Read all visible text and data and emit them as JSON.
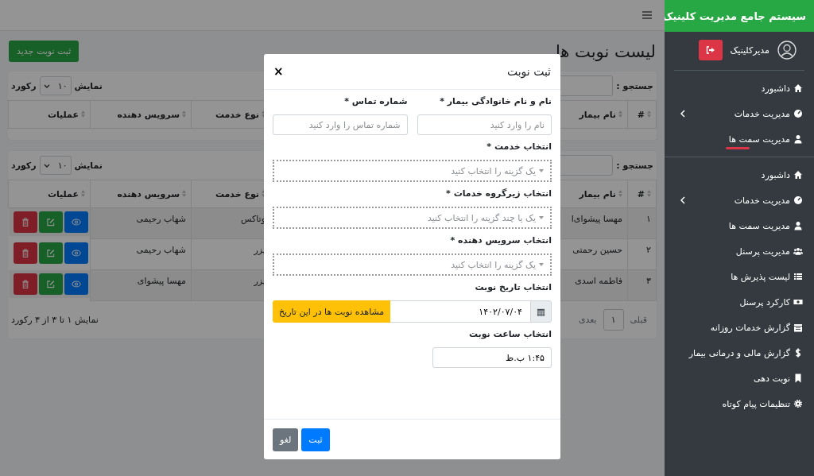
{
  "sidebar": {
    "brand": "سیستم جامع مدیریت کلینیک",
    "user": "مدیرکلینیک",
    "menus": [
      {
        "underline": true,
        "items": [
          {
            "label": "داشبورد",
            "has_submenu": false
          },
          {
            "label": "مدیریت خدمات",
            "has_submenu": true
          },
          {
            "label": "مدیریت سمت ها",
            "has_submenu": false
          }
        ]
      },
      {
        "underline": false,
        "items": [
          {
            "label": "داشبورد",
            "has_submenu": false
          },
          {
            "label": "مدیریت خدمات",
            "has_submenu": true
          },
          {
            "label": "مدیریت سمت ها",
            "has_submenu": false
          },
          {
            "label": "مدیریت پرسنل",
            "has_submenu": false
          },
          {
            "label": "لیست پذیرش ها",
            "has_submenu": false
          },
          {
            "label": "کارکرد پرسنل",
            "has_submenu": false
          },
          {
            "label": "گزارش خدمات روزانه",
            "has_submenu": false
          },
          {
            "label": "گزارش مالی و درمانی بیمار",
            "has_submenu": false
          },
          {
            "label": "نوبت دهی",
            "has_submenu": false
          },
          {
            "label": "تنظیمات پیام کوتاه",
            "has_submenu": false
          }
        ]
      }
    ]
  },
  "page": {
    "title": "لیست نوبت ها",
    "new_button": "ثبت نوبت جدید",
    "tables": [
      {
        "clipped": true,
        "search_label": "جستجو :",
        "show_label": "نمایش",
        "page_size": "۱۰",
        "records_label": "رکورد",
        "columns": [
          "#",
          "نام بیمار",
          "نوع خدمت",
          "سرویس دهنده",
          "عملیات"
        ]
      },
      {
        "clipped": false,
        "search_label": "جستجو :",
        "show_label": "نمایش",
        "page_size": "۱۰",
        "records_label": "رکورد",
        "columns": [
          "#",
          "نام بیمار",
          "نوع خدمت",
          "سرویس دهنده",
          "عملیات"
        ],
        "rows": [
          {
            "number": "۱",
            "patient": "مهسا پیشوای‌ا",
            "service": "وتاکس",
            "provider": "شهاب رحیمی"
          },
          {
            "number": "۲",
            "patient": "حسین رحمتی",
            "service": "یزر",
            "provider": "شهاب رحیمی"
          },
          {
            "number": "۳",
            "patient": "فاطمه اسدی",
            "service": "یزر",
            "provider": "مهسا پیشوای"
          }
        ],
        "prev": "قبلی",
        "current_page": "۱",
        "next": "بعدی",
        "info": "نمایش ۱ تا ۳ از ۳ رکورد"
      }
    ]
  },
  "modal": {
    "title": "ثبت نوبت",
    "close": "×",
    "fields": [
      {
        "kind": "text",
        "label": "نام و نام خانوادگی بیمار *",
        "placeholder": "نام را وارد کنید"
      },
      {
        "kind": "text",
        "label": "شماره تماس *",
        "placeholder": "شماره تماس را وارد کنید"
      },
      {
        "kind": "select",
        "label": "انتخاب خدمت *",
        "placeholder": "یک گزینه را انتخاب کنید"
      },
      {
        "kind": "select",
        "label": "انتخاب زیرگروه خدمات *",
        "placeholder": "یک یا چند گزینه را انتخاب کنید"
      },
      {
        "kind": "select",
        "label": "انتخاب سرویس دهنده *",
        "placeholder": "یک گزینه را انتخاب کنید"
      },
      {
        "kind": "date",
        "label": "انتخاب تاریخ نوبت",
        "value": "۱۴۰۲/۰۷/۰۴",
        "button": "مشاهده نوبت ها در این تاریخ"
      },
      {
        "kind": "time",
        "label": "انتخاب ساعت نوبت",
        "value": "۱:۴۵ ب.ظ"
      }
    ],
    "buttons": [
      {
        "kind": "primary",
        "label": "ثبت"
      },
      {
        "kind": "secondary",
        "label": "لغو"
      }
    ]
  }
}
